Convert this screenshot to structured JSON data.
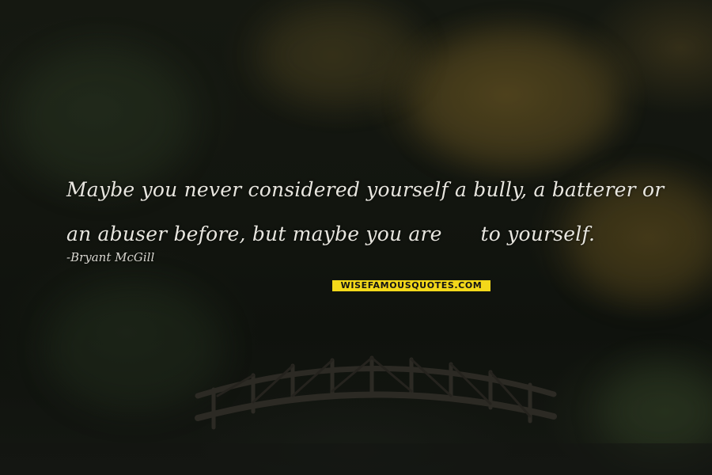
{
  "quote": {
    "line1": "Maybe you never considered yourself a bully, a batterer or",
    "line2": "an abuser before, but maybe you are      to yourself."
  },
  "author": "-Bryant McGill",
  "watermark": "WISEFAMOUSQUOTES.COM",
  "colors": {
    "text": "#e8e6df",
    "watermark_bg": "#f3d81a",
    "watermark_text": "#141414",
    "background": "#12150f"
  }
}
